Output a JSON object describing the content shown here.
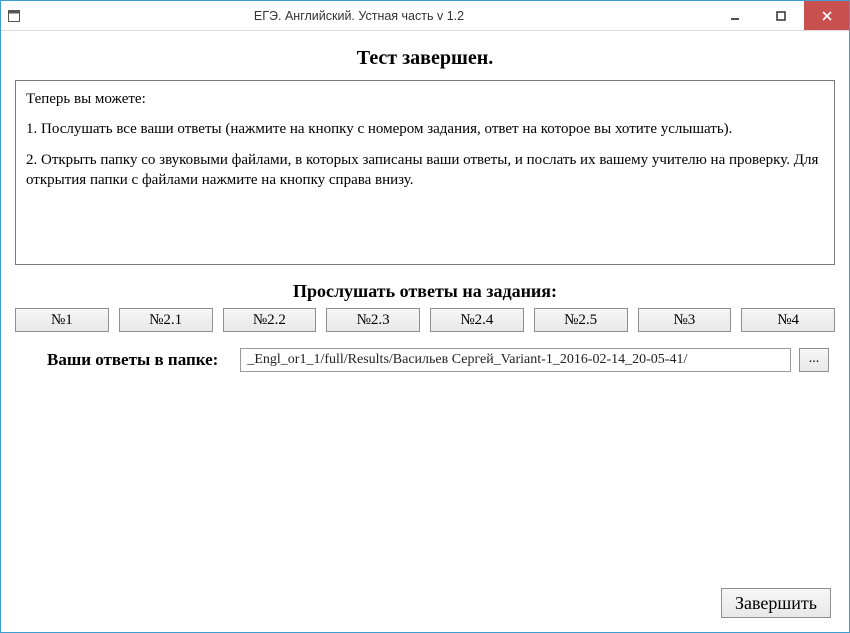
{
  "window": {
    "title": "ЕГЭ. Английский. Устная часть v 1.2"
  },
  "heading": "Тест завершен.",
  "info": {
    "p1": "Теперь вы можете:",
    "p2": "1. Послушать все ваши ответы (нажмите на кнопку с номером задания, ответ на которое вы хотите услышать).",
    "p3": "2. Открыть папку со звуковыми файлами, в которых записаны ваши ответы, и послать их вашему учителю на проверку. Для открытия папки с файлами нажмите на кнопку справа внизу."
  },
  "listen_label": "Прослушать ответы на задания:",
  "tasks": [
    "№1",
    "№2.1",
    "№2.2",
    "№2.3",
    "№2.4",
    "№2.5",
    "№3",
    "№4"
  ],
  "folder": {
    "label": "Ваши ответы в папке:",
    "path": "_Engl_or1_1/full/Results/Васильев Сергей_Variant-1_2016-02-14_20-05-41/",
    "browse": "..."
  },
  "finish": "Завершить"
}
